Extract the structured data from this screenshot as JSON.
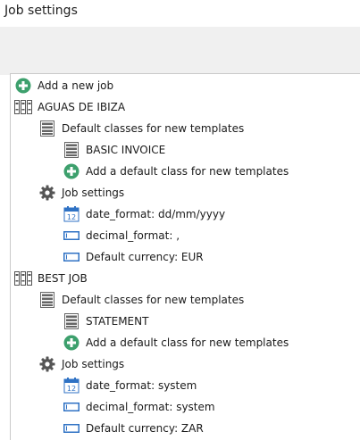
{
  "window": {
    "title": "Job settings"
  },
  "tree": {
    "add_job": {
      "label": "Add a new job",
      "icon": "add-icon"
    },
    "jobs": [
      {
        "name": "AGUAS DE IBIZA",
        "icon": "binders-icon",
        "classes_label": "Default classes for new templates",
        "classes": [
          "BASIC INVOICE"
        ],
        "add_class_label": "Add a default class for new templates",
        "settings_label": "Job settings",
        "settings": [
          {
            "label": "date_format: dd/mm/yyyy",
            "icon": "calendar-icon"
          },
          {
            "label": "decimal_format: ,",
            "icon": "textbox-icon"
          },
          {
            "label": "Default currency: EUR",
            "icon": "textbox-icon"
          }
        ]
      },
      {
        "name": "BEST JOB",
        "icon": "binders-icon",
        "classes_label": "Default classes for new templates",
        "classes": [
          "STATEMENT"
        ],
        "add_class_label": "Add a default class for new templates",
        "settings_label": "Job settings",
        "settings": [
          {
            "label": "date_format: system",
            "icon": "calendar-icon"
          },
          {
            "label": "decimal_format: system",
            "icon": "textbox-icon"
          },
          {
            "label": "Default currency: ZAR",
            "icon": "textbox-icon"
          }
        ]
      }
    ]
  },
  "colors": {
    "add_icon": "#3da06d",
    "textbox_icon": "#2f72c4",
    "calendar_icon": "#2f72c4",
    "gear_icon": "#555555",
    "list_icon": "#666666"
  }
}
